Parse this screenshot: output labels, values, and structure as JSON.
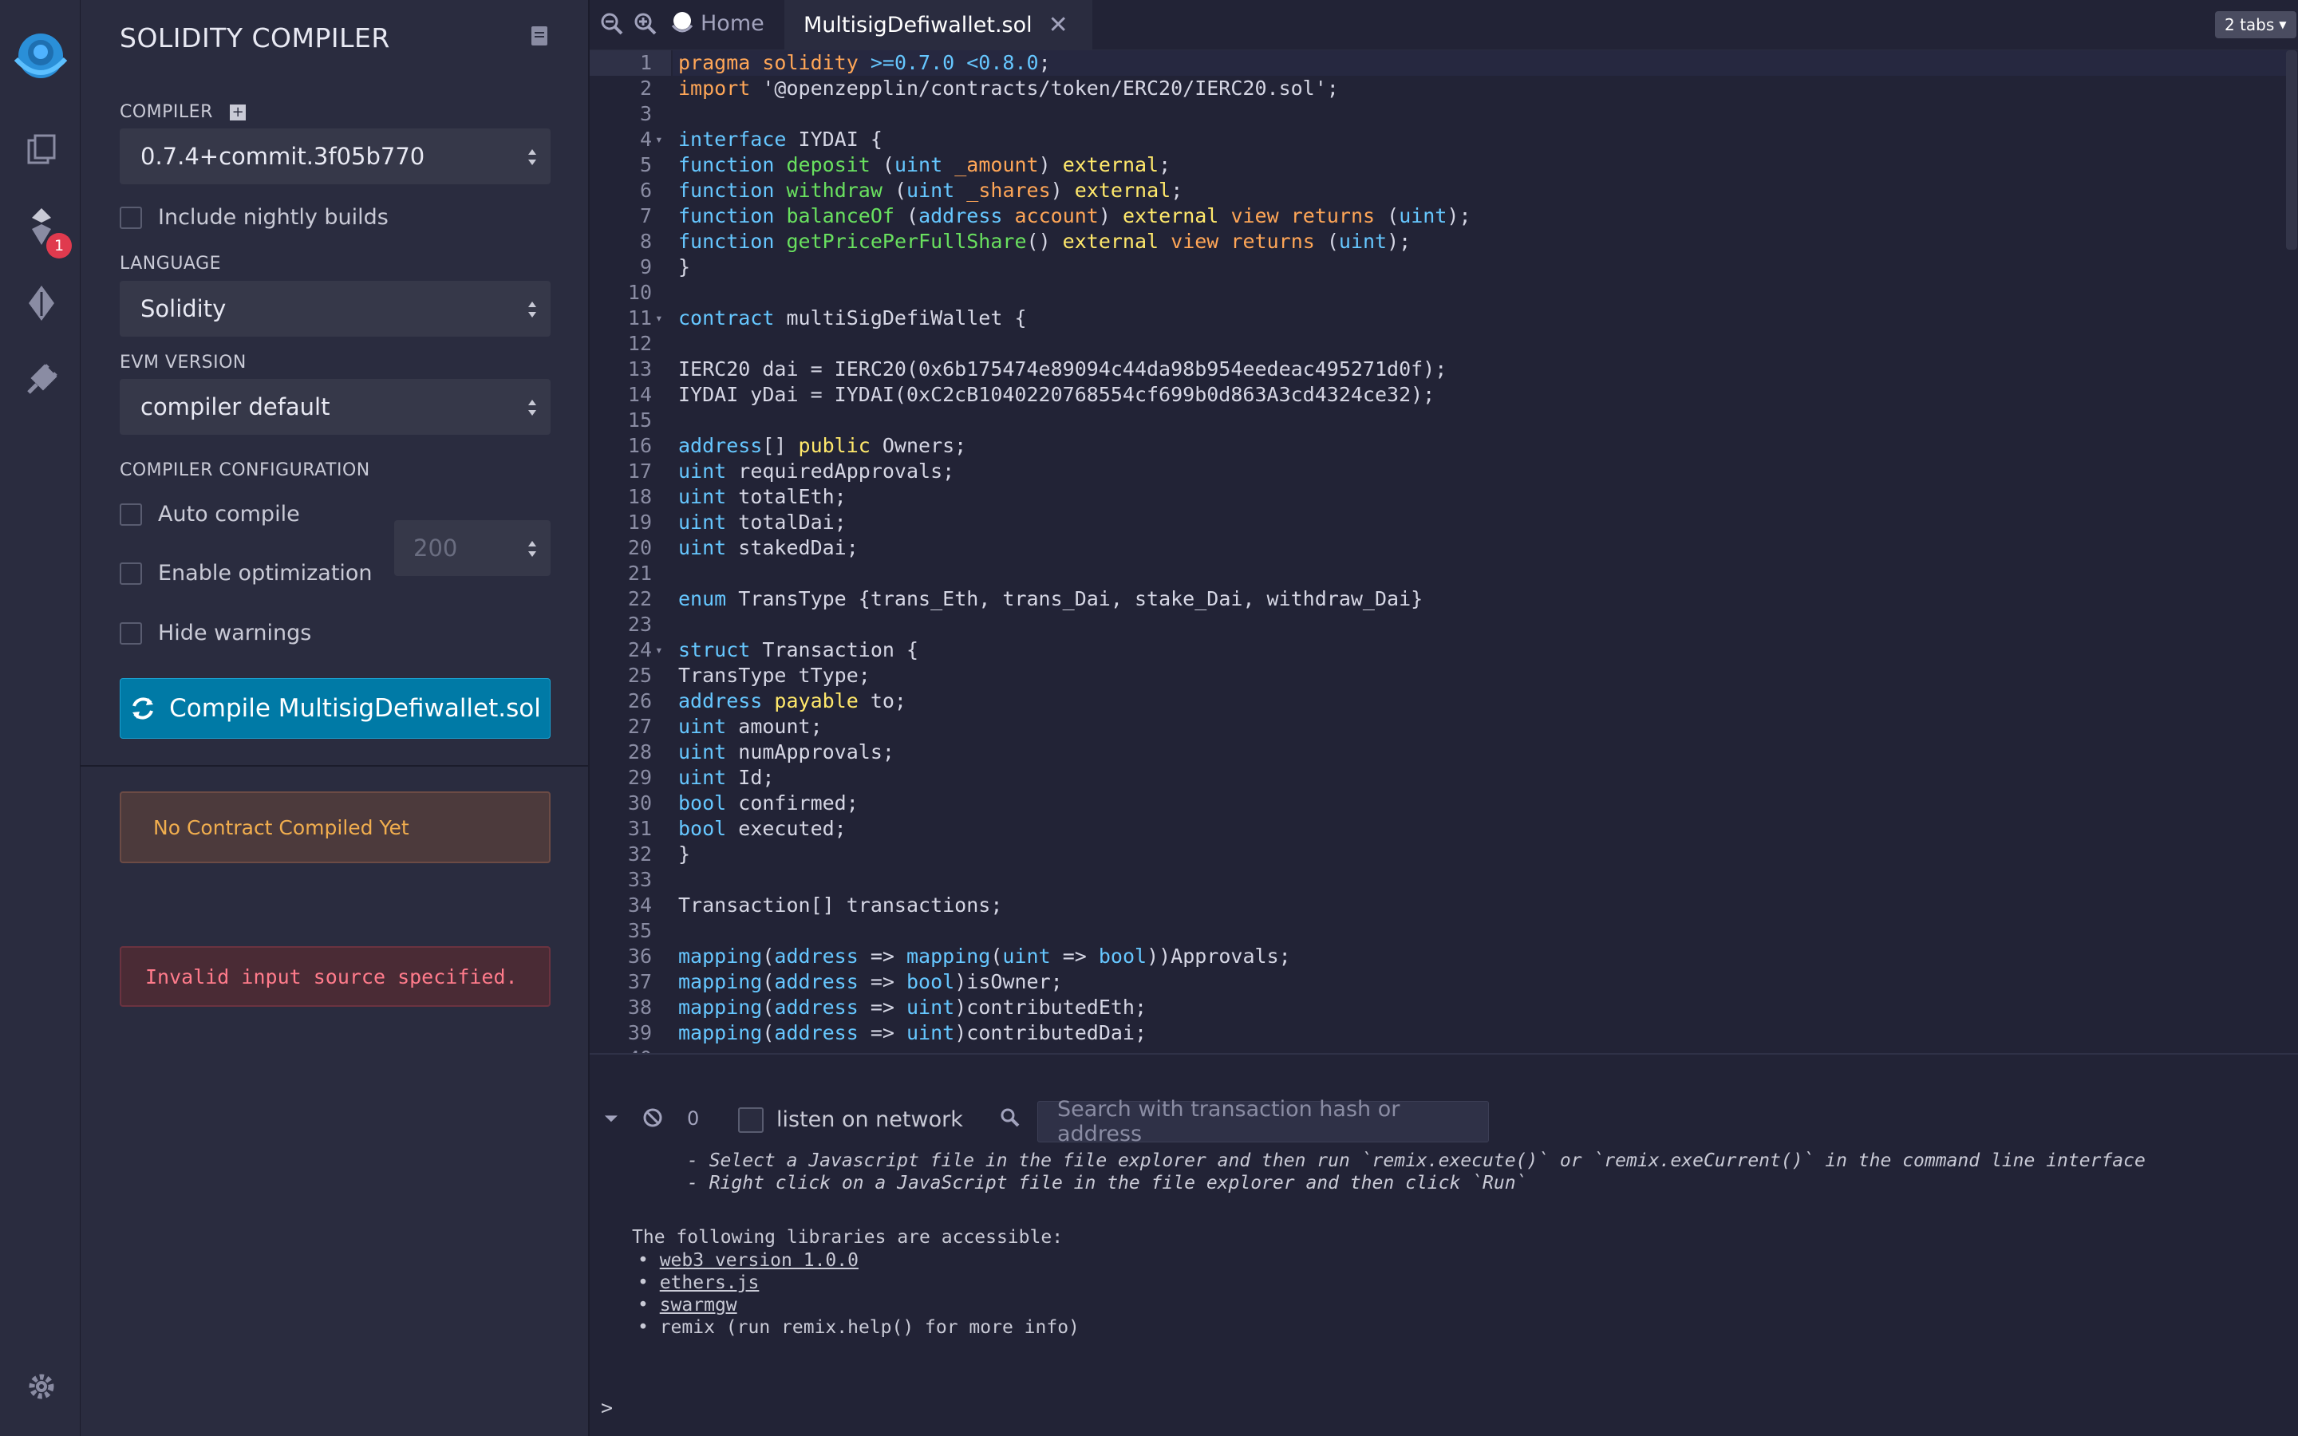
{
  "sidepanel": {
    "title": "SOLIDITY COMPILER",
    "compiler_label": "COMPILER",
    "compiler_version": "0.7.4+commit.3f05b770",
    "nightly_label": "Include nightly builds",
    "language_label": "LANGUAGE",
    "language_value": "Solidity",
    "evm_label": "EVM VERSION",
    "evm_value": "compiler default",
    "config_label": "COMPILER CONFIGURATION",
    "auto_compile_label": "Auto compile",
    "optimization_label": "Enable optimization",
    "optimization_runs": "200",
    "hide_warnings_label": "Hide warnings",
    "compile_button": "Compile MultisigDefiwallet.sol",
    "no_contract": "No Contract Compiled Yet",
    "error": "Invalid input source specified."
  },
  "iconbar": {
    "badge": "1",
    "icons": [
      "remix-logo-icon",
      "file-explorer-icon",
      "solidity-compiler-icon",
      "deploy-run-icon",
      "plugin-manager-icon",
      "settings-icon"
    ]
  },
  "tabs": {
    "home_label": "Home",
    "file_label": "MultisigDefiwallet.sol",
    "tabs_count": "2 tabs"
  },
  "editor": {
    "lines": [
      {
        "n": "1",
        "fold": "",
        "h": "<span class='kw'>pragma solidity</span> <span class='kw2'>&gt;=0.7.0 &lt;0.8.0</span>;"
      },
      {
        "n": "2",
        "fold": "",
        "h": "<span class='kw'>import</span> '@openzepplin/contracts/token/ERC20/IERC20.sol';"
      },
      {
        "n": "3",
        "fold": "",
        "h": ""
      },
      {
        "n": "4",
        "fold": "▾",
        "h": "<span class='kw2'>interface</span> IYDAI {"
      },
      {
        "n": "5",
        "fold": "",
        "h": "<span class='kw2'>function</span> <span class='fn'>deposit</span> (<span class='kw2'>uint</span> <span class='kw'>_amount</span>) <span class='yl'>external</span>;"
      },
      {
        "n": "6",
        "fold": "",
        "h": "<span class='kw2'>function</span> <span class='fn'>withdraw</span> (<span class='kw2'>uint</span> <span class='kw'>_shares</span>) <span class='yl'>external</span>;"
      },
      {
        "n": "7",
        "fold": "",
        "h": "<span class='kw2'>function</span> <span class='fn'>balanceOf</span> (<span class='kw2'>address</span> <span class='kw'>account</span>) <span class='yl'>external</span> <span class='kw'>view</span> <span class='kw'>returns</span> (<span class='kw2'>uint</span>);"
      },
      {
        "n": "8",
        "fold": "",
        "h": "<span class='kw2'>function</span> <span class='fn'>getPricePerFullShare</span>() <span class='yl'>external</span> <span class='kw'>view</span> <span class='kw'>returns</span> (<span class='kw2'>uint</span>);"
      },
      {
        "n": "9",
        "fold": "",
        "h": "}"
      },
      {
        "n": "10",
        "fold": "",
        "h": ""
      },
      {
        "n": "11",
        "fold": "▾",
        "h": "<span class='kw2'>contract</span> multiSigDefiWallet {"
      },
      {
        "n": "12",
        "fold": "",
        "h": ""
      },
      {
        "n": "13",
        "fold": "",
        "h": "IERC20 dai = IERC20(0x6b175474e89094c44da98b954eedeac495271d0f);"
      },
      {
        "n": "14",
        "fold": "",
        "h": "IYDAI yDai = IYDAI(0xC2cB1040220768554cf699b0d863A3cd4324ce32);"
      },
      {
        "n": "15",
        "fold": "",
        "h": ""
      },
      {
        "n": "16",
        "fold": "",
        "h": "<span class='kw2'>address</span>[] <span class='yl'>public</span> Owners;"
      },
      {
        "n": "17",
        "fold": "",
        "h": "<span class='kw2'>uint</span> requiredApprovals;"
      },
      {
        "n": "18",
        "fold": "",
        "h": "<span class='kw2'>uint</span> totalEth;"
      },
      {
        "n": "19",
        "fold": "",
        "h": "<span class='kw2'>uint</span> totalDai;"
      },
      {
        "n": "20",
        "fold": "",
        "h": "<span class='kw2'>uint</span> stakedDai;"
      },
      {
        "n": "21",
        "fold": "",
        "h": ""
      },
      {
        "n": "22",
        "fold": "",
        "h": "<span class='kw2'>enum</span> TransType {trans_Eth, trans_Dai, stake_Dai, withdraw_Dai}"
      },
      {
        "n": "23",
        "fold": "",
        "h": ""
      },
      {
        "n": "24",
        "fold": "▾",
        "h": "<span class='kw2'>struct</span> Transaction {"
      },
      {
        "n": "25",
        "fold": "",
        "h": "TransType tType;"
      },
      {
        "n": "26",
        "fold": "",
        "h": "<span class='kw2'>address</span> <span class='yl'>payable</span> to;"
      },
      {
        "n": "27",
        "fold": "",
        "h": "<span class='kw2'>uint</span> amount;"
      },
      {
        "n": "28",
        "fold": "",
        "h": "<span class='kw2'>uint</span> numApprovals;"
      },
      {
        "n": "29",
        "fold": "",
        "h": "<span class='kw2'>uint</span> Id;"
      },
      {
        "n": "30",
        "fold": "",
        "h": "<span class='kw2'>bool</span> confirmed;"
      },
      {
        "n": "31",
        "fold": "",
        "h": "<span class='kw2'>bool</span> executed;"
      },
      {
        "n": "32",
        "fold": "",
        "h": "}"
      },
      {
        "n": "33",
        "fold": "",
        "h": ""
      },
      {
        "n": "34",
        "fold": "",
        "h": "Transaction[] transactions;"
      },
      {
        "n": "35",
        "fold": "",
        "h": ""
      },
      {
        "n": "36",
        "fold": "",
        "h": "<span class='kw2'>mapping</span>(<span class='kw2'>address</span> =&gt; <span class='kw2'>mapping</span>(<span class='kw2'>uint</span> =&gt; <span class='kw2'>bool</span>))Approvals;"
      },
      {
        "n": "37",
        "fold": "",
        "h": "<span class='kw2'>mapping</span>(<span class='kw2'>address</span> =&gt; <span class='kw2'>bool</span>)isOwner;"
      },
      {
        "n": "38",
        "fold": "",
        "h": "<span class='kw2'>mapping</span>(<span class='kw2'>address</span> =&gt; <span class='kw2'>uint</span>)contributedEth;"
      },
      {
        "n": "39",
        "fold": "",
        "h": "<span class='kw2'>mapping</span>(<span class='kw2'>address</span> =&gt; <span class='kw2'>uint</span>)contributedDai;"
      },
      {
        "n": "40",
        "fold": "",
        "h": ""
      }
    ]
  },
  "terminal": {
    "pending_count": "0",
    "listen_label": "listen on network",
    "search_placeholder": "Search with transaction hash or address",
    "hint1": "- Select a Javascript file in the file explorer and then run `remix.execute()` or `remix.exeCurrent()` in the command line interface",
    "hint2": "- Right click on a JavaScript file in the file explorer and then click `Run`",
    "libs_title": "The following libraries are accessible:",
    "lib1": "web3 version 1.0.0",
    "lib2": "ethers.js",
    "lib3": "swarmgw",
    "lib4": "remix (run remix.help() for more info)",
    "prompt": ">"
  }
}
